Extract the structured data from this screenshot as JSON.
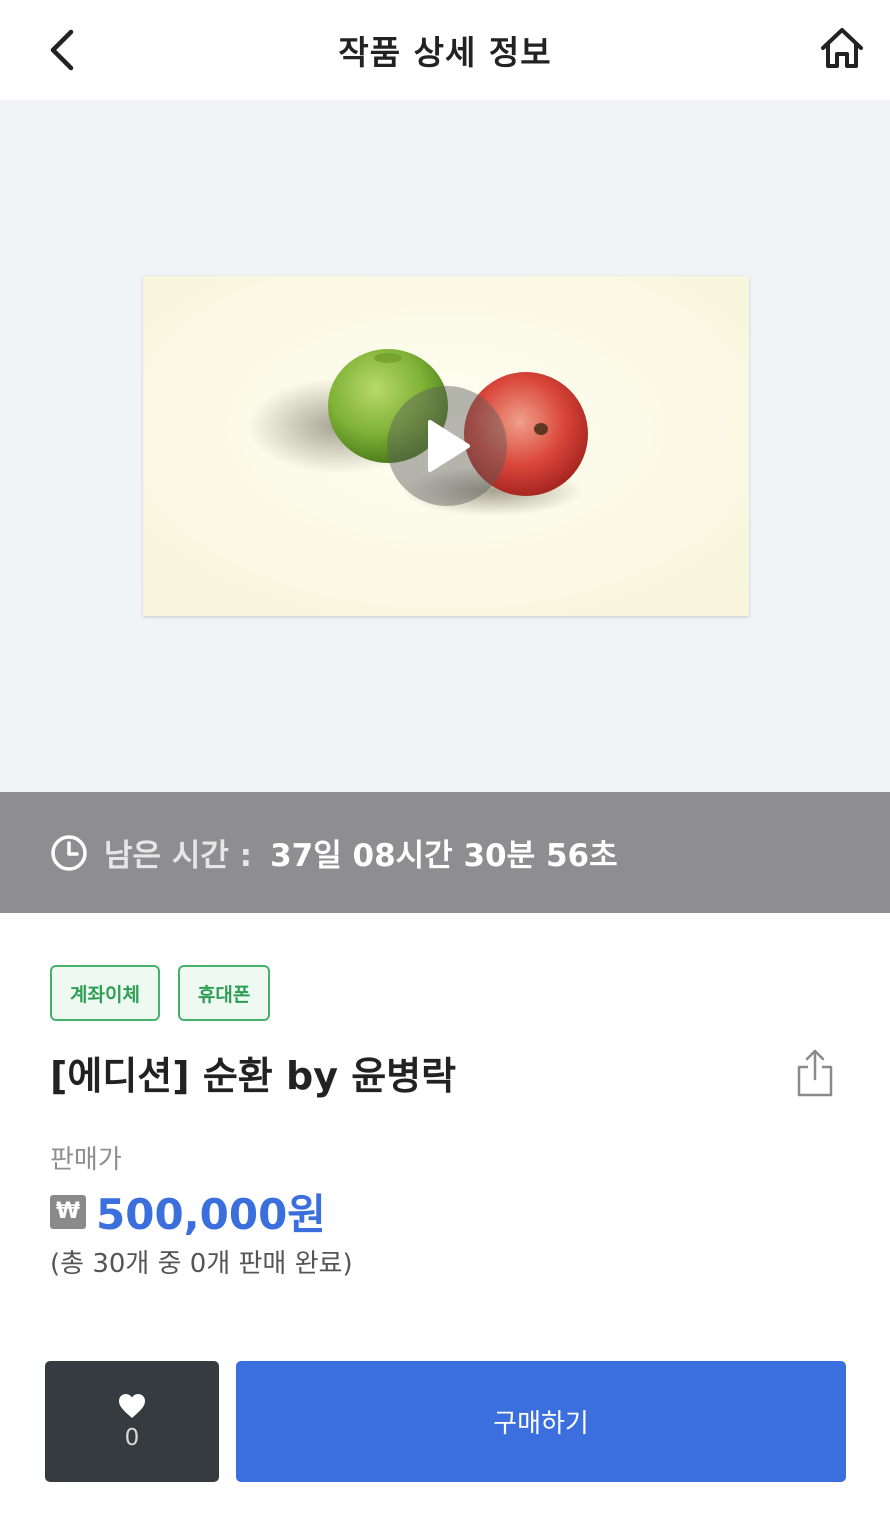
{
  "header": {
    "title": "작품 상세 정보",
    "back_icon": "chevron-left-icon",
    "home_icon": "home-icon"
  },
  "media": {
    "type": "video",
    "play_icon": "play-icon",
    "background": "#f0f4f6"
  },
  "timer": {
    "icon": "clock-icon",
    "label": "남은 시간 :",
    "value": "37일 08시간 30분 56초"
  },
  "product": {
    "tags": [
      "계좌이체",
      "휴대폰"
    ],
    "title": "[에디션] 순환 by 윤병락",
    "share_icon": "share-icon",
    "price_label": "판매가",
    "currency_symbol": "₩",
    "price": "500,000원",
    "sales_status": "(총 30개 중 0개 판매 완료)"
  },
  "actions": {
    "like_icon": "heart-icon",
    "like_count": "0",
    "buy_label": "구매하기"
  },
  "colors": {
    "accent": "#3b6fde",
    "tag_green": "#2f9e55",
    "timer_bar": "#8e8e90",
    "like_button": "#363b40"
  }
}
